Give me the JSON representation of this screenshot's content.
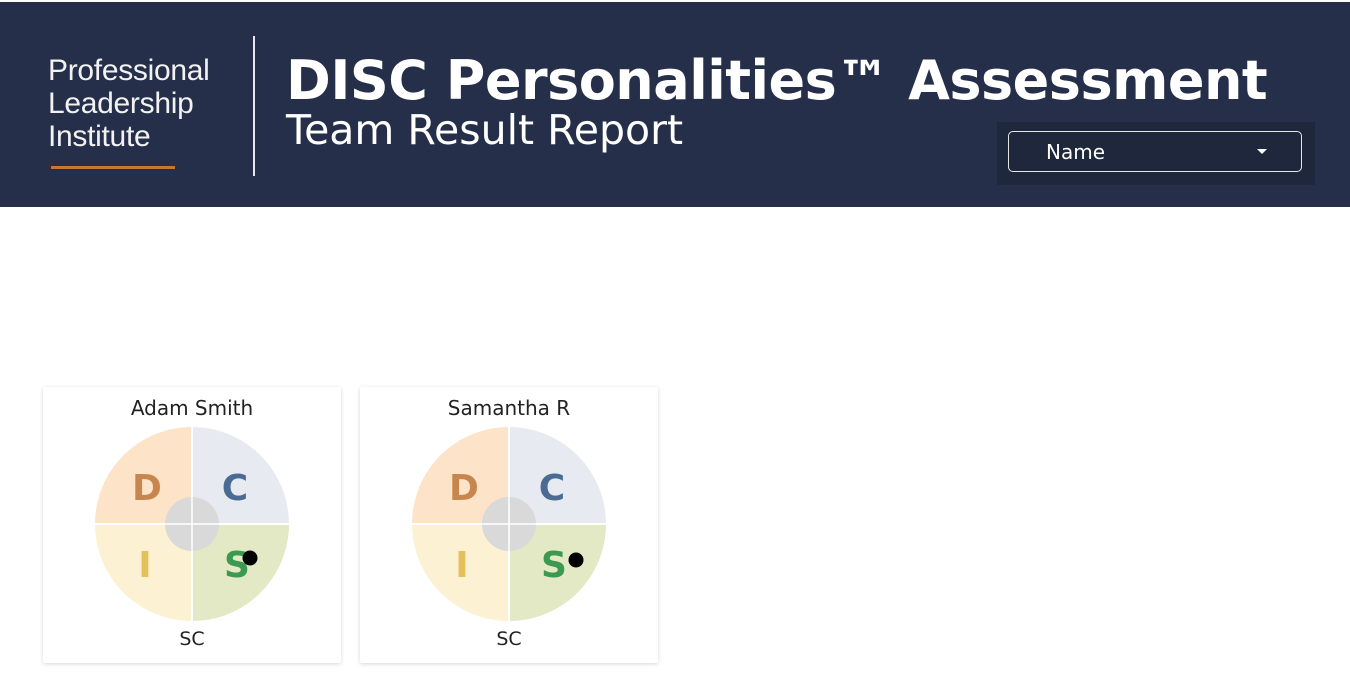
{
  "header": {
    "logo_lines": [
      "Professional",
      "Leadership",
      "Institute"
    ],
    "title": "DISC Personalities™ Assessment",
    "subtitle": "Team Result Report",
    "filter": {
      "label": "Name",
      "icon": "caret-down-icon"
    }
  },
  "colors": {
    "header_bg": "#252f49",
    "logo_accent": "#c8772e",
    "D_fill": "#fde3c8",
    "C_fill": "#e7ebf1",
    "I_fill": "#fdf1d3",
    "S_fill": "#e2e9c4",
    "D_letter": "#c8864f",
    "C_letter": "#4a6b93",
    "I_letter": "#e3c05c",
    "S_letter": "#3b9950",
    "center": "#d9d9d9",
    "marker": "#000000"
  },
  "quadrants": {
    "D": "D",
    "C": "C",
    "I": "I",
    "S": "S"
  },
  "cards": [
    {
      "name": "Adam Smith",
      "style": "SC"
    },
    {
      "name": "Samantha R",
      "style": "SC"
    }
  ]
}
